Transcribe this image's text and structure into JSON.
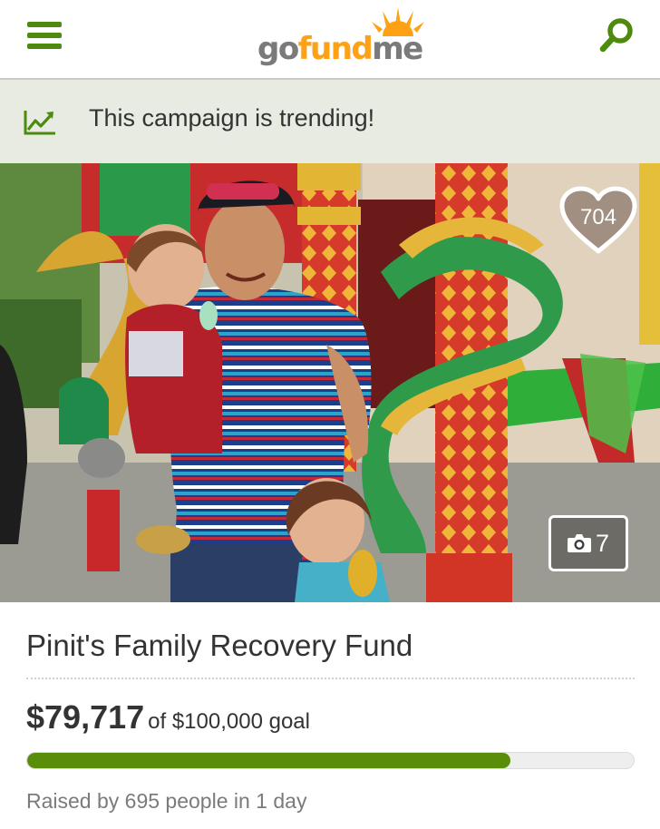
{
  "header": {
    "logo": {
      "part1": "go",
      "part2": "fund",
      "part3": "me"
    },
    "menu_icon": "hamburger-menu-icon",
    "search_icon": "search-icon",
    "accent_color": "#4e8a0e",
    "logo_orange": "#ffa114"
  },
  "banner": {
    "icon": "trending-chart-icon",
    "text": "This campaign is trending!",
    "background": "#e7ebe2"
  },
  "hero": {
    "heart_count": "704",
    "photo_count": "7",
    "heart_icon": "heart-icon",
    "camera_icon": "camera-icon"
  },
  "campaign": {
    "title": "Pinit's Family Recovery Fund",
    "raised": "$79,717",
    "goal_text": "of $100,000 goal",
    "progress_fraction": 0.79717,
    "progress_color": "#5a8e0a",
    "raised_by": "Raised by 695 people in 1 day"
  }
}
